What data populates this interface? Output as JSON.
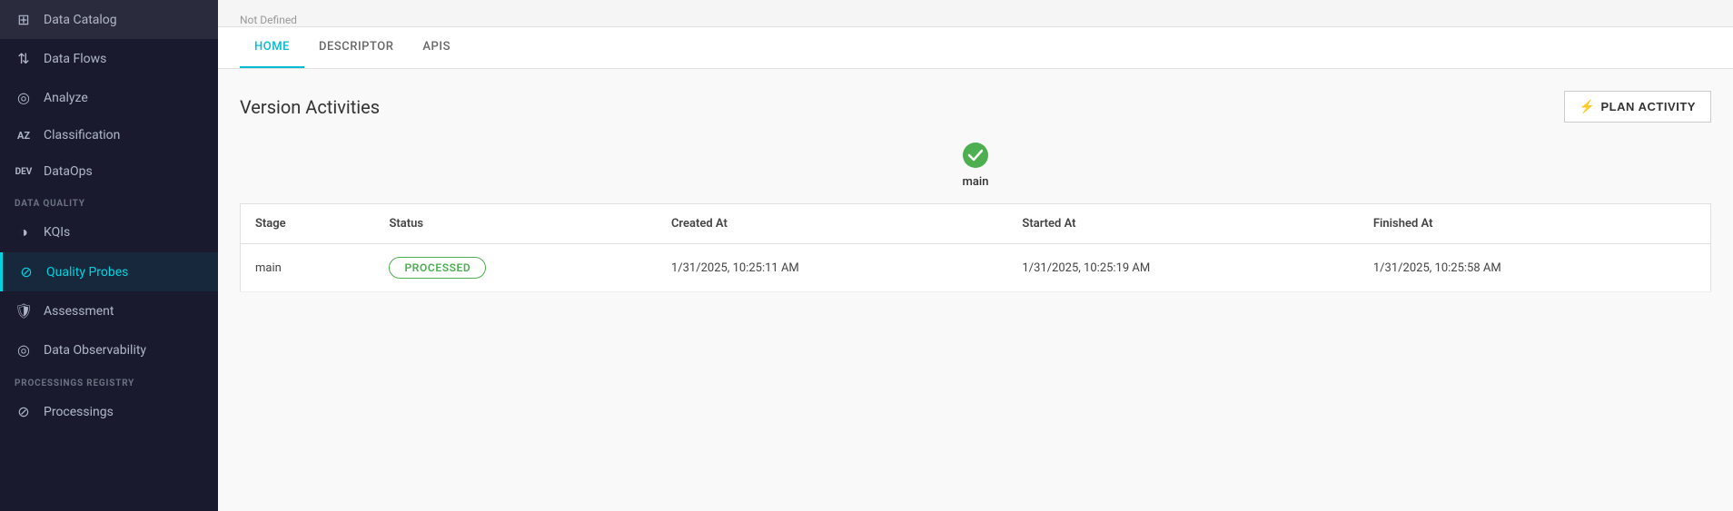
{
  "sidebar": {
    "items": [
      {
        "id": "data-catalog",
        "label": "Data Catalog",
        "icon": "⊞"
      },
      {
        "id": "data-flows",
        "label": "Data Flows",
        "icon": "↕"
      },
      {
        "id": "analyze",
        "label": "Analyze",
        "icon": "⊙"
      },
      {
        "id": "classification",
        "label": "Classification",
        "icon": "AZ"
      },
      {
        "id": "dataops",
        "label": "DataOps",
        "icon": "DEV"
      }
    ],
    "sections": [
      {
        "label": "DATA QUALITY",
        "items": [
          {
            "id": "kqis",
            "label": "KQIs",
            "icon": "◑"
          },
          {
            "id": "quality-probes",
            "label": "Quality Probes",
            "icon": "⊘",
            "active": true
          },
          {
            "id": "assessment",
            "label": "Assessment",
            "icon": "✓"
          },
          {
            "id": "data-observability",
            "label": "Data Observability",
            "icon": "⊙"
          }
        ]
      },
      {
        "label": "PROCESSINGS REGISTRY",
        "items": [
          {
            "id": "processings",
            "label": "Processings",
            "icon": "⊘"
          }
        ]
      }
    ]
  },
  "tabs": [
    {
      "id": "home",
      "label": "HOME",
      "active": true
    },
    {
      "id": "descriptor",
      "label": "DESCRIPTOR",
      "active": false
    },
    {
      "id": "apis",
      "label": "APIS",
      "active": false
    }
  ],
  "content": {
    "section_title": "Version Activities",
    "plan_activity_button": "PLAN ACTIVITY",
    "pipeline_node_label": "main",
    "table": {
      "columns": [
        "Stage",
        "Status",
        "Created At",
        "Started At",
        "Finished At"
      ],
      "rows": [
        {
          "stage": "main",
          "status": "PROCESSED",
          "created_at": "1/31/2025, 10:25:11 AM",
          "started_at": "1/31/2025, 10:25:19 AM",
          "finished_at": "1/31/2025, 10:25:58 AM"
        }
      ]
    }
  }
}
